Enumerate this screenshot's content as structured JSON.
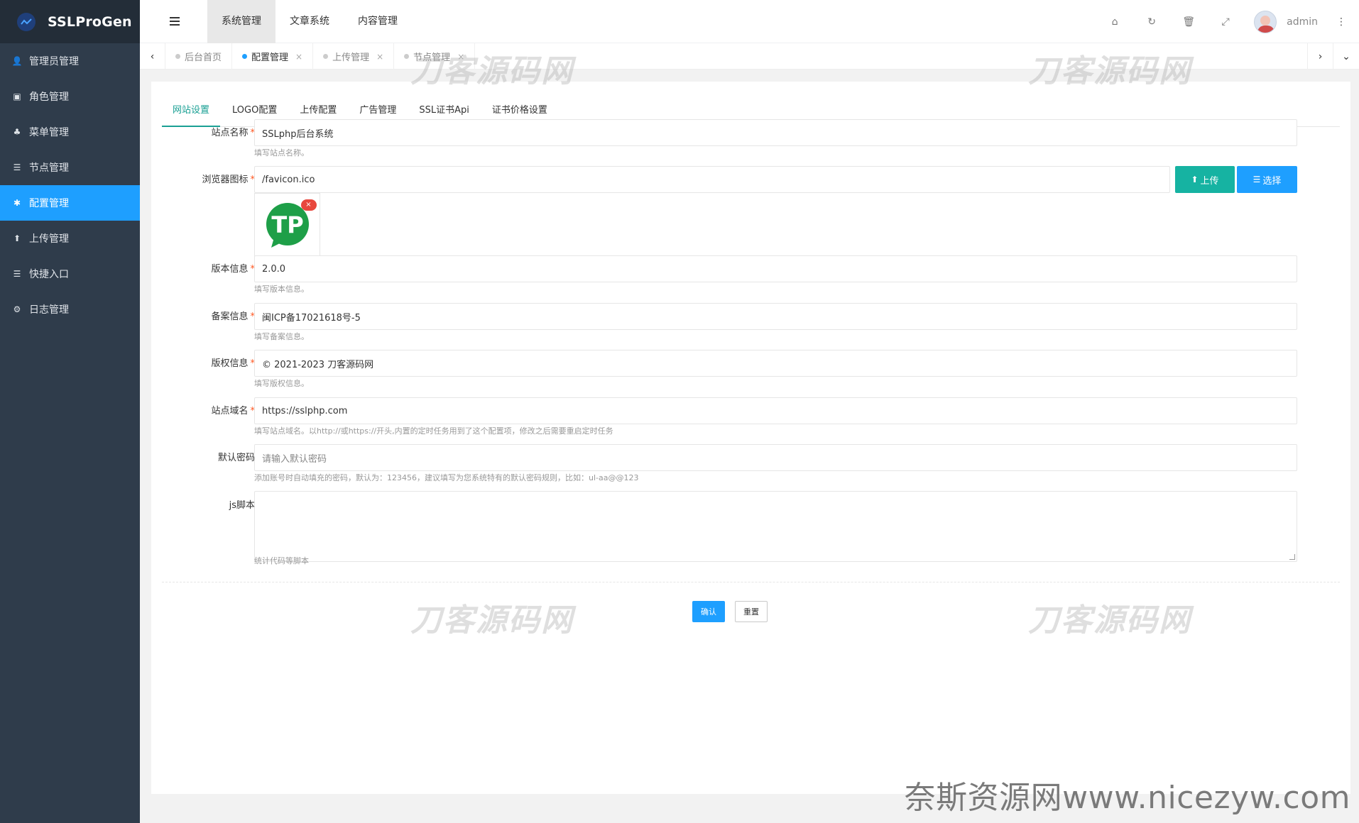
{
  "app": {
    "name": "SSLProGen"
  },
  "sidebar": {
    "items": [
      {
        "label": "管理员管理",
        "icon": "user-icon",
        "glyph": "👤"
      },
      {
        "label": "角色管理",
        "icon": "role-icon",
        "glyph": "▣"
      },
      {
        "label": "菜单管理",
        "icon": "tree-icon",
        "glyph": "♣"
      },
      {
        "label": "节点管理",
        "icon": "list-icon",
        "glyph": "☰"
      },
      {
        "label": "配置管理",
        "icon": "gear-icon",
        "glyph": "✱"
      },
      {
        "label": "上传管理",
        "icon": "arrow-up-icon",
        "glyph": "⬆"
      },
      {
        "label": "快捷入口",
        "icon": "list-icon",
        "glyph": "☰"
      },
      {
        "label": "日志管理",
        "icon": "log-icon",
        "glyph": "⚙"
      }
    ],
    "active_index": 4
  },
  "header": {
    "tabs": [
      "系统管理",
      "文章系统",
      "内容管理"
    ],
    "active_tab": 0,
    "icons": [
      "home-icon",
      "refresh-icon",
      "trash-icon",
      "fullscreen-icon"
    ],
    "username": "admin"
  },
  "tabbar": {
    "tabs": [
      {
        "label": "后台首页",
        "closable": false
      },
      {
        "label": "配置管理",
        "closable": true
      },
      {
        "label": "上传管理",
        "closable": true
      },
      {
        "label": "节点管理",
        "closable": true
      }
    ],
    "active_index": 1
  },
  "form": {
    "tabs": [
      "网站设置",
      "LOGO配置",
      "上传配置",
      "广告管理",
      "SSL证书Api",
      "证书价格设置"
    ],
    "active_tab": 0,
    "site_name": {
      "label": "站点名称",
      "value": "SSLphp后台系统",
      "help": "填写站点名称。"
    },
    "favicon": {
      "label": "浏览器图标",
      "value": "/favicon.ico",
      "upload_label": "上传",
      "choose_label": "选择",
      "preview_text": "TP",
      "remove_glyph": "×"
    },
    "version": {
      "label": "版本信息",
      "value": "2.0.0",
      "help": "填写版本信息。"
    },
    "icp": {
      "label": "备案信息",
      "value": "闽ICP备17021618号-5",
      "help": "填写备案信息。"
    },
    "copyright": {
      "label": "版权信息",
      "value": "© 2021-2023 刀客源码网",
      "help": "填写版权信息。"
    },
    "domain": {
      "label": "站点域名",
      "value": "https://sslphp.com",
      "help": "填写站点域名。以http://或https://开头,内置的定时任务用到了这个配置项，修改之后需要重启定时任务"
    },
    "default_password": {
      "label": "默认密码",
      "placeholder": "请输入默认密码",
      "help": "添加账号时自动填充的密码，默认为：123456，建议填写为您系统特有的默认密码规则，比如：ul-aa@@123"
    },
    "js_script": {
      "label": "js脚本",
      "value": "",
      "help": "统计代码等脚本"
    },
    "required_mark": "*",
    "confirm_label": "确认",
    "reset_label": "重置"
  },
  "watermarks": {
    "text": "刀客源码网",
    "footer": "奈斯资源网www.nicezyw.com"
  },
  "colors": {
    "sidebar": "#2f3c4b",
    "accent": "#1e9fff",
    "teal": "#16b3a2",
    "tab_active": "#1aa094",
    "required": "#ff5722"
  }
}
